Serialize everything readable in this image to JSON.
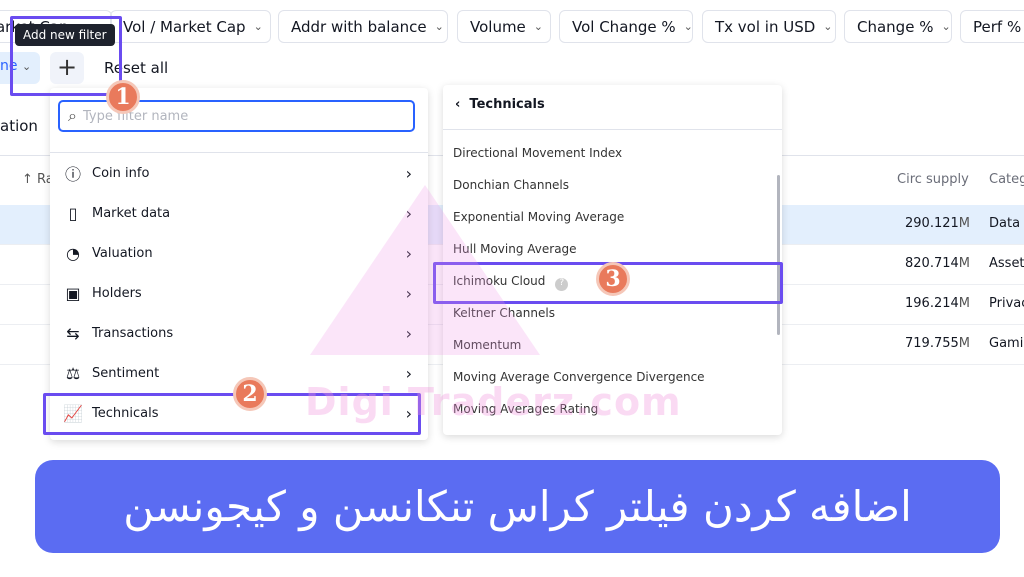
{
  "filters": [
    "Market Cap",
    "Vol / Market Cap",
    "Addr with balance",
    "Volume",
    "Vol Change %",
    "Tx vol in USD",
    "Change %",
    "Perf %"
  ],
  "tooltip": "Add new filter",
  "partial_chip": "ne",
  "reset_label": "Reset all",
  "tab_partial": "ation",
  "table": {
    "rank_header": "Ra",
    "circ_header": "Circ supply",
    "cat_header": "Categ",
    "rows": [
      {
        "circ": "290.121",
        "unit": "M",
        "cat": "Data"
      },
      {
        "circ": "820.714",
        "unit": "M",
        "cat": "Asset-"
      },
      {
        "circ": "196.214",
        "unit": "M",
        "cat": "Privac"
      },
      {
        "circ": "719.755",
        "unit": "M",
        "cat": "Gamin"
      }
    ]
  },
  "search": {
    "placeholder": "Type filter name"
  },
  "menu": [
    {
      "label": "Coin info",
      "icon": "info-icon"
    },
    {
      "label": "Market data",
      "icon": "candlestick-icon"
    },
    {
      "label": "Valuation",
      "icon": "pie-chart-icon"
    },
    {
      "label": "Holders",
      "icon": "wallet-icon"
    },
    {
      "label": "Transactions",
      "icon": "arrows-icon"
    },
    {
      "label": "Sentiment",
      "icon": "scales-icon"
    },
    {
      "label": "Technicals",
      "icon": "chart-line-icon"
    }
  ],
  "submenu": {
    "title": "Technicals",
    "items": [
      "Directional Movement Index",
      "Donchian Channels",
      "Exponential Moving Average",
      "Hull Moving Average",
      "Ichimoku Cloud",
      "Keltner Channels",
      "Momentum",
      "Moving Average Convergence Divergence",
      "Moving Averages Rating"
    ]
  },
  "badges": [
    "1",
    "2",
    "3"
  ],
  "watermark": "Digi Traderz.com",
  "banner": "اضافه کردن فیلتر کراس تنکانسن و کیجونسن",
  "colors": {
    "accent": "#2962ff",
    "highlight": "#6a4cf0",
    "badge": "#e97a5c",
    "banner": "#5b6cf2"
  }
}
